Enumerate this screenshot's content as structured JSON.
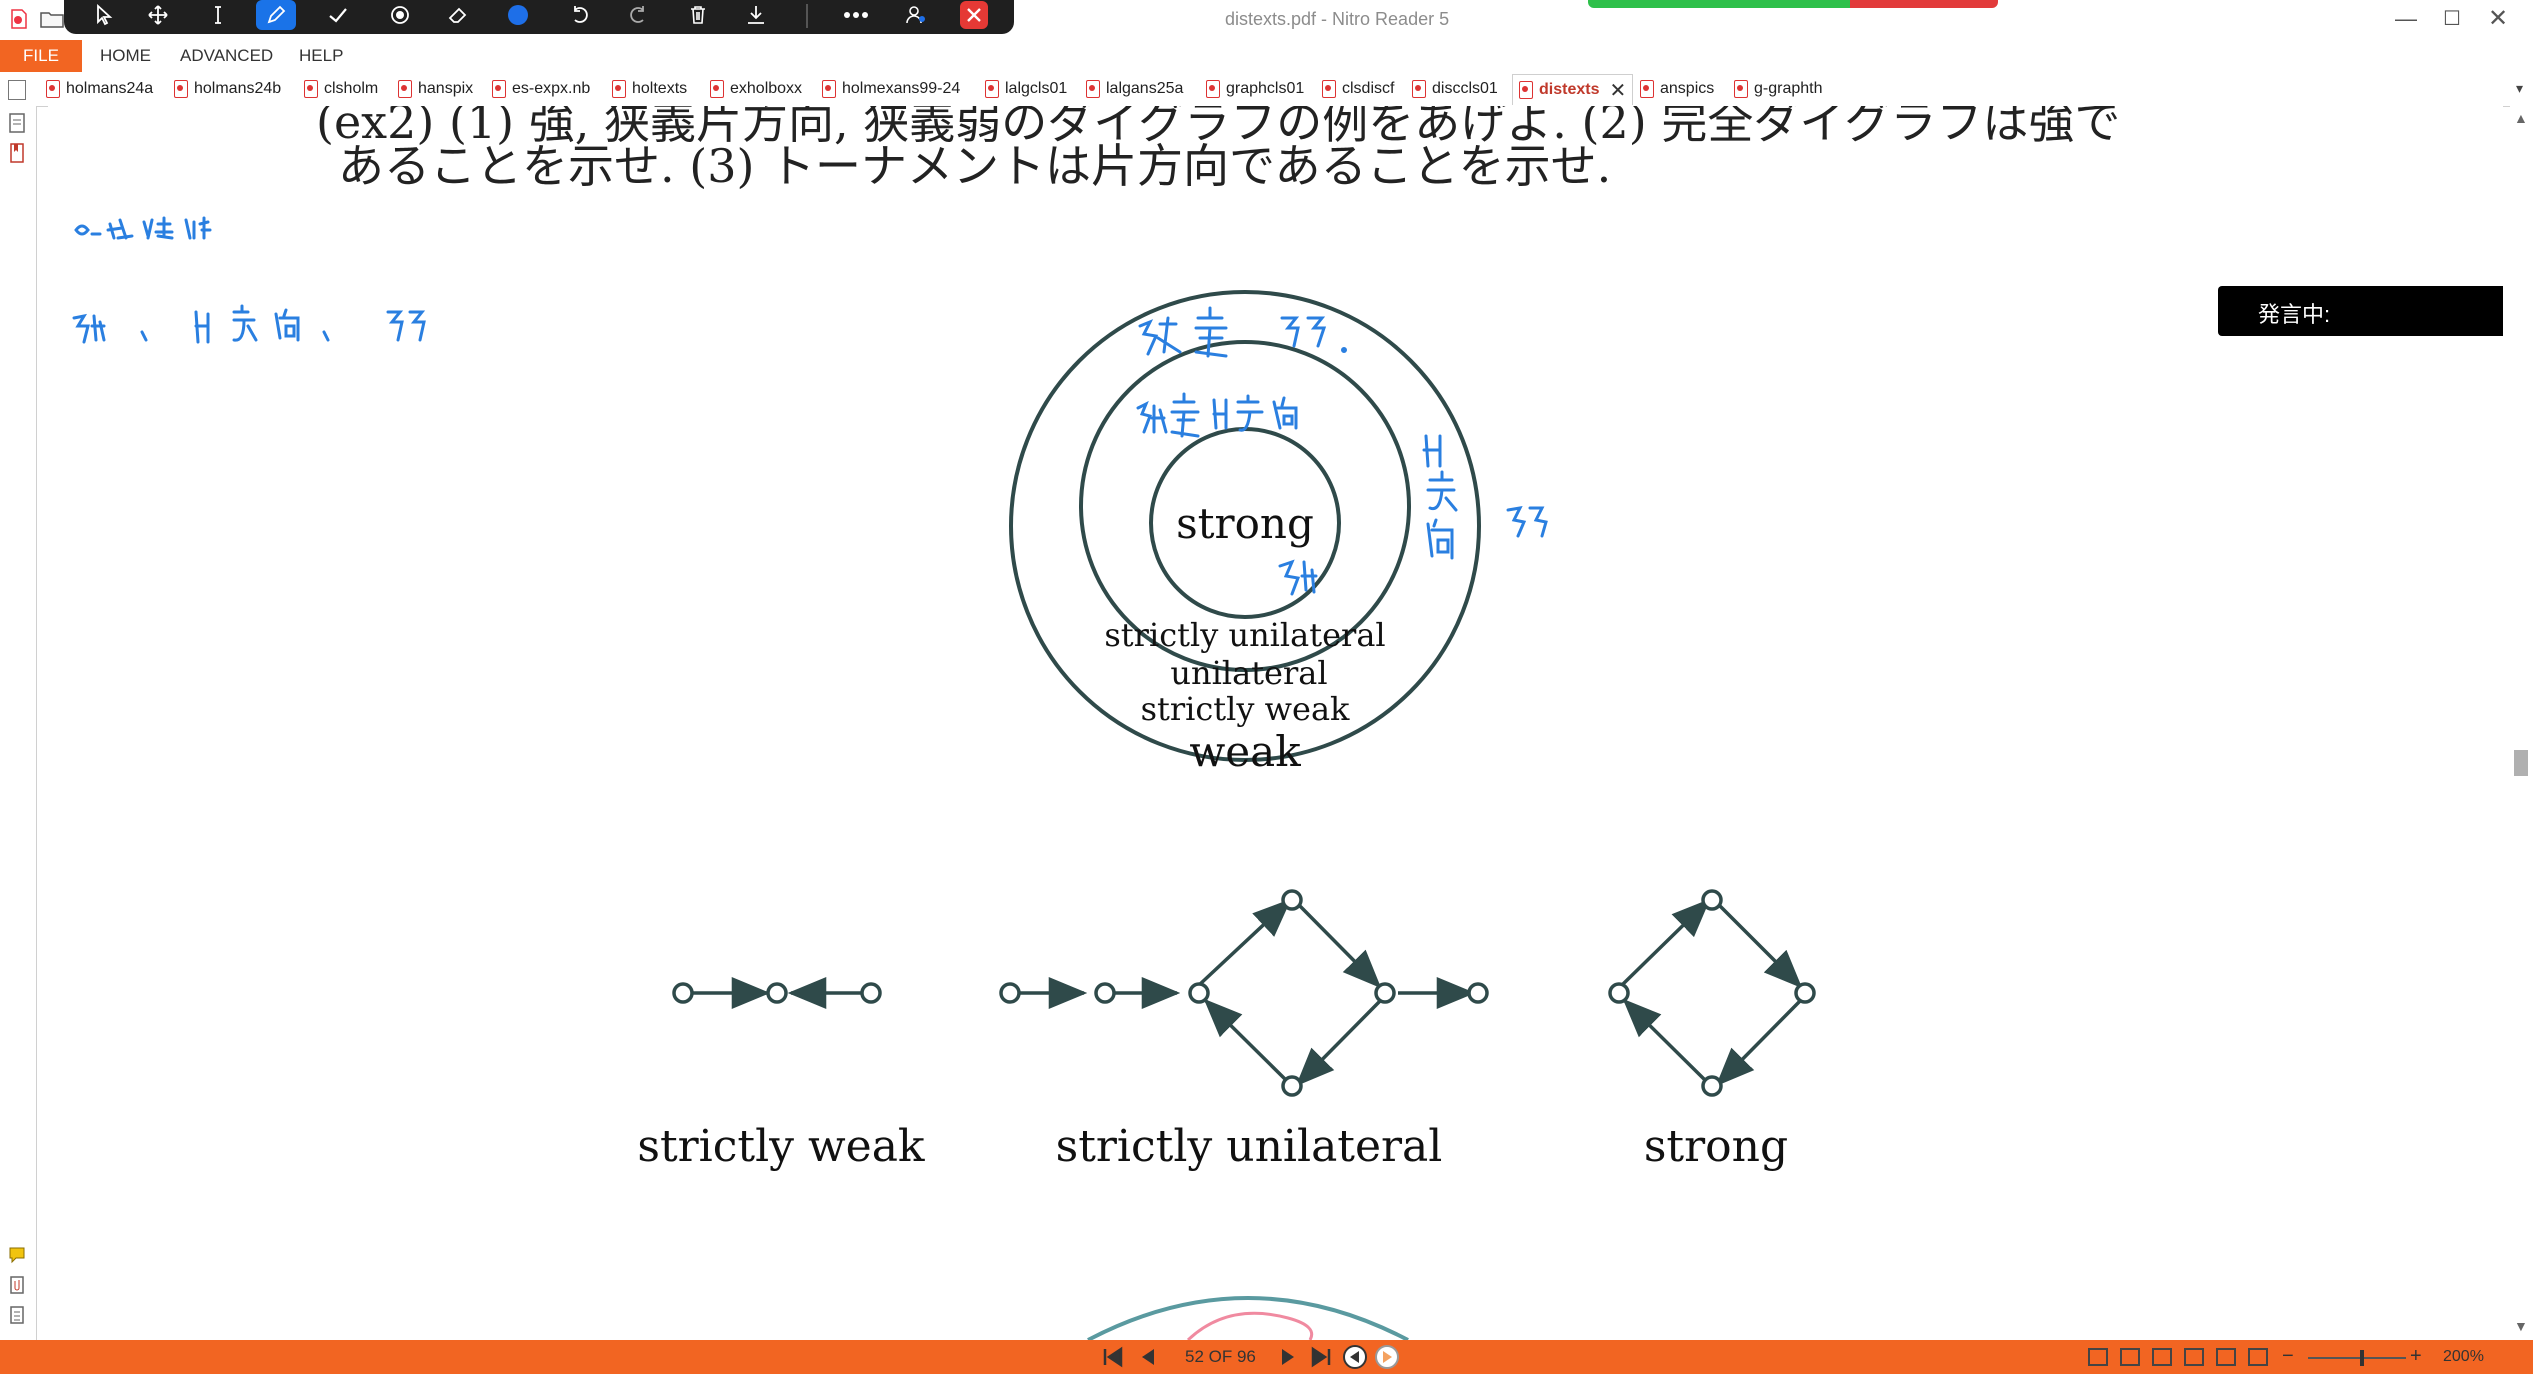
{
  "window": {
    "title": "distexts.pdf - Nitro Reader 5",
    "minimize": "—",
    "maximize": "☐",
    "close": "✕"
  },
  "menu": {
    "file": "FILE",
    "items": [
      "HOME",
      "ADVANCED",
      "HELP"
    ]
  },
  "tabs": [
    {
      "label": "holmans24a"
    },
    {
      "label": "holmans24b"
    },
    {
      "label": "clsholm"
    },
    {
      "label": "hanspix"
    },
    {
      "label": "es-expx.nb"
    },
    {
      "label": "holtexts"
    },
    {
      "label": "exholboxx"
    },
    {
      "label": "holmexans99-24"
    },
    {
      "label": "lalgcls01"
    },
    {
      "label": "lalgans25a"
    },
    {
      "label": "graphcls01"
    },
    {
      "label": "clsdiscf"
    },
    {
      "label": "disccls01"
    },
    {
      "label": "distexts",
      "active": true
    },
    {
      "label": "anspics"
    },
    {
      "label": "g-graphth"
    }
  ],
  "tab_close": "✕",
  "tab_overflow": "▾",
  "document": {
    "line1": "(ex2) (1) 強, 狭義片方向, 狭義弱のダイグラフの例をあげよ. (2) 完全ダイグラフは強で",
    "line2": "あることを示せ. (3) トーナメントは片方向であることを示せ.",
    "diagram_labels": {
      "strong": "strong",
      "strictly_unilateral": "strictly unilateral",
      "unilateral": "unilateral",
      "strictly_weak": "strictly weak",
      "weak": "weak"
    },
    "example_captions": [
      "strictly weak",
      "strictly unilateral",
      "strong"
    ]
  },
  "speaking_overlay": {
    "label": "発言中:"
  },
  "status": {
    "page": "52 OF 96",
    "zoom": "200%",
    "zoom_minus": "−",
    "zoom_plus": "+"
  },
  "colors": {
    "accent_orange": "#f26522",
    "ink_blue": "#2a7fe0",
    "diagram_stroke": "#2f4a4a",
    "tab_active_red": "#c0392b"
  },
  "icons": [
    "nitro-logo-icon",
    "folder-icon",
    "select-arrow-icon",
    "move-icon",
    "text-cursor-icon",
    "pen-icon",
    "check-icon",
    "highlighter-icon",
    "eraser-icon",
    "color-dot-icon",
    "undo-icon",
    "redo-icon",
    "trash-icon",
    "download-icon",
    "more-icon",
    "user-settings-icon",
    "close-annotation-icon"
  ]
}
